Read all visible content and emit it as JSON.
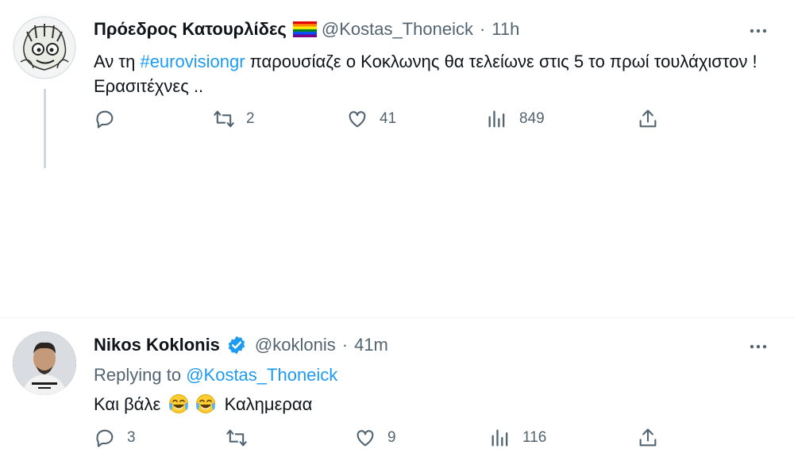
{
  "tweets": [
    {
      "name": "Πρόεδρος Κατουρλίδες",
      "handle": "@Kostas_Thoneick",
      "separator": "·",
      "time": "11h",
      "text_before": "Αν τη",
      "hashtag": "#eurovisiongr",
      "text_after": "παρουσίαζε ο Κοκλωνης θα τελείωνε στις 5 το πρωί τουλάχιστον ! Ερασιτέχνες ..",
      "stats": {
        "replies": "",
        "retweets": "2",
        "likes": "41",
        "views": "849"
      }
    },
    {
      "name": "Nikos Koklonis",
      "handle": "@koklonis",
      "separator": "·",
      "time": "41m",
      "replying_label": "Replying to",
      "replying_handle": "@Kostas_Thoneick",
      "text_start": "Και βάλε",
      "text_end": "Καλημεραα",
      "stats": {
        "replies": "3",
        "retweets": "",
        "likes": "9",
        "views": "116"
      }
    }
  ],
  "colors": {
    "accent": "#1d9bf0",
    "muted": "#536471",
    "text": "#0f1419"
  },
  "icons": [
    "more-icon",
    "reply-icon",
    "retweet-icon",
    "like-icon",
    "views-icon",
    "share-icon",
    "verified-icon",
    "rainbow-flag-icon",
    "crying-laughing-emoji"
  ]
}
